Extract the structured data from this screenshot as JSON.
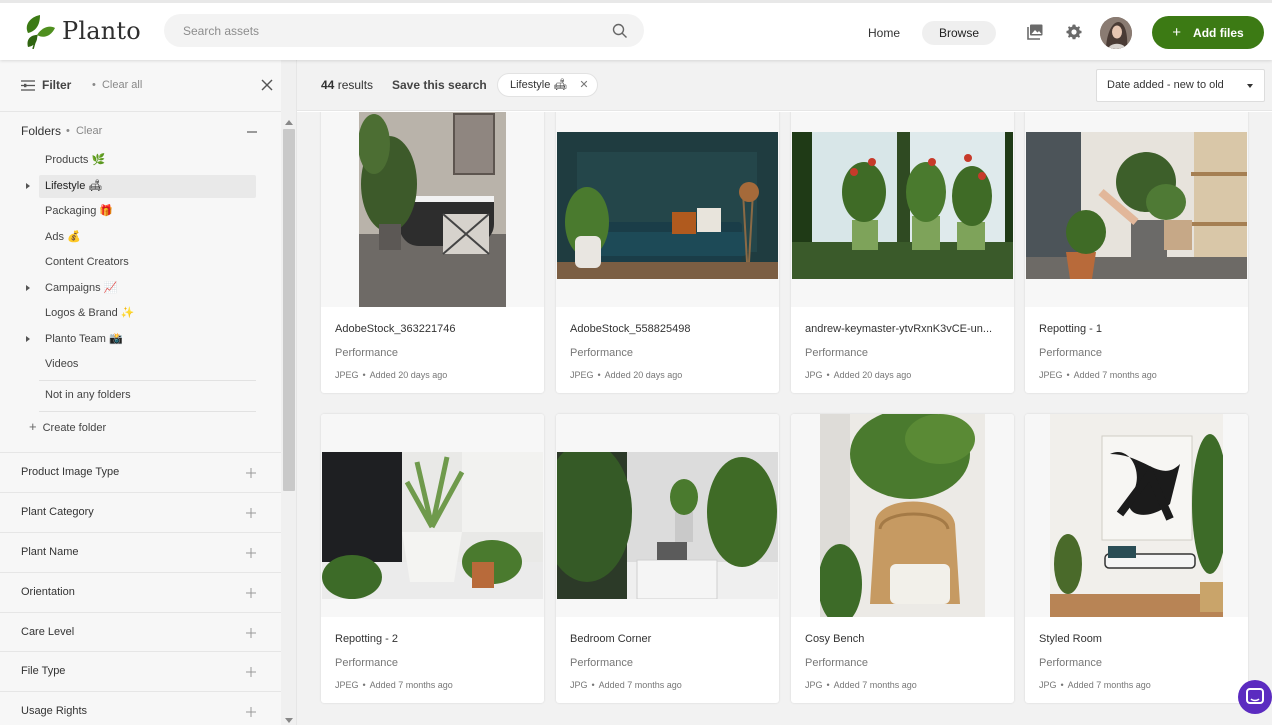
{
  "app": {
    "logo_text": "Planto",
    "brand_color": "#3c7a14"
  },
  "header": {
    "search_placeholder": "Search assets",
    "nav_home": "Home",
    "nav_browse": "Browse",
    "add_files": "Add files",
    "icons": [
      "gallery-icon",
      "settings-gear-icon",
      "search-icon",
      "plus-icon"
    ]
  },
  "filter": {
    "title": "Filter",
    "clear_all": "Clear all"
  },
  "folders": {
    "title": "Folders",
    "clear": "Clear",
    "items": [
      {
        "label": "Products 🌿",
        "has_children": false,
        "active": false
      },
      {
        "label": "Lifestyle 🛋",
        "has_children": true,
        "active": true
      },
      {
        "label": "Packaging 🎁",
        "has_children": false,
        "active": false
      },
      {
        "label": "Ads 💰",
        "has_children": false,
        "active": false
      },
      {
        "label": "Content Creators",
        "has_children": false,
        "active": false
      },
      {
        "label": "Campaigns 📈",
        "has_children": true,
        "active": false
      },
      {
        "label": "Logos & Brand ✨",
        "has_children": false,
        "active": false
      },
      {
        "label": "Planto Team 📸",
        "has_children": true,
        "active": false
      },
      {
        "label": "Videos",
        "has_children": false,
        "active": false
      }
    ],
    "not_in_folders": "Not in any folders",
    "create_folder": "Create folder"
  },
  "facets": [
    "Product Image Type",
    "Plant Category",
    "Plant Name",
    "Orientation",
    "Care Level",
    "File Type",
    "Usage Rights"
  ],
  "results": {
    "count": "44",
    "count_suffix": "results",
    "save_search": "Save this search",
    "chip_label": "Lifestyle 🛋",
    "sort_label": "Date added - new to old"
  },
  "assets": [
    {
      "title": "AdobeStock_363221746",
      "tag": "Performance",
      "type": "JPEG",
      "added": "Added 20 days ago"
    },
    {
      "title": "AdobeStock_558825498",
      "tag": "Performance",
      "type": "JPEG",
      "added": "Added 20 days ago"
    },
    {
      "title": "andrew-keymaster-ytvRxnK3vCE-un...",
      "tag": "Performance",
      "type": "JPG",
      "added": "Added 20 days ago"
    },
    {
      "title": "Repotting - 1",
      "tag": "Performance",
      "type": "JPEG",
      "added": "Added 7 months ago"
    },
    {
      "title": "Repotting - 2",
      "tag": "Performance",
      "type": "JPEG",
      "added": "Added 7 months ago"
    },
    {
      "title": "Bedroom Corner",
      "tag": "Performance",
      "type": "JPG",
      "added": "Added 7 months ago"
    },
    {
      "title": "Cosy Bench",
      "tag": "Performance",
      "type": "JPG",
      "added": "Added 7 months ago"
    },
    {
      "title": "Styled Room",
      "tag": "Performance",
      "type": "JPG",
      "added": "Added 7 months ago"
    }
  ]
}
